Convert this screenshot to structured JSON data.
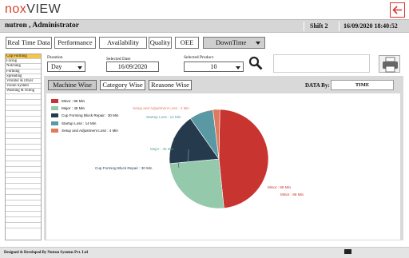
{
  "app": {
    "logo_prefix": "no",
    "logo_x": "x",
    "logo_suffix": "VIEW"
  },
  "header": {
    "user": "nutron , Administrator",
    "shift": "Shift 2",
    "datetime": "16/09/2020 18:40:52"
  },
  "nav": {
    "real_time": "Real Time Data",
    "performance": "Performance",
    "availability": "Availability",
    "quality": "Quality",
    "oee": "OEE",
    "downtime": "DownTime"
  },
  "sidebar": {
    "items": [
      "Cup Forming",
      "Facing",
      "Notching",
      "Forming",
      "Spreading",
      "Vibrator & Dryer",
      "Vision System",
      "Washing & Oiling"
    ]
  },
  "filters": {
    "duration_label": "Duration",
    "duration_value": "Day",
    "date_label": "Selected Date",
    "date_value": "16/09/2020",
    "product_label": "Selected Product",
    "product_value": "10"
  },
  "tabs": {
    "machine": "Machine Wise",
    "category": "Category Wise",
    "reason": "Reasone Wise"
  },
  "data_by": {
    "label": "DATA By:",
    "value": "TIME"
  },
  "footer": {
    "text": "Designed & Developed By Nutron Systems Pvt. Ltd"
  },
  "colors": {
    "accent": "#d2442c",
    "minor": "#c8342f",
    "major": "#94c9ac",
    "cup": "#263a4e",
    "startup": "#5a98a4",
    "setup": "#e07a5e"
  },
  "chart_data": {
    "type": "pie",
    "categories": [
      "Minor",
      "Major",
      "Cup Forming Block Repair",
      "Startup Loss",
      "Setup and Adjustment Loss"
    ],
    "values": [
      86,
      45,
      30,
      14,
      4
    ],
    "legend": [
      "Minor : 86  Min",
      "Major : 45  Min",
      "Cup Forming Block Repair : 30  Min",
      "Startup Loss : 14  Min",
      "Setup and Adjustment Loss :  4  Min"
    ],
    "labels": [
      "Minor : 86  Min",
      "Major : 45  Min",
      "Cup Forming Block Repair : 30  Min",
      "Startup Loss : 14  Min",
      "Setup and Adjustment Loss : 4  Min"
    ],
    "minor_label_2": "Minor : 86  Min",
    "colors": [
      "#c8342f",
      "#94c9ac",
      "#263a4e",
      "#5a98a4",
      "#e07a5e"
    ],
    "legend_position": "top-left"
  }
}
